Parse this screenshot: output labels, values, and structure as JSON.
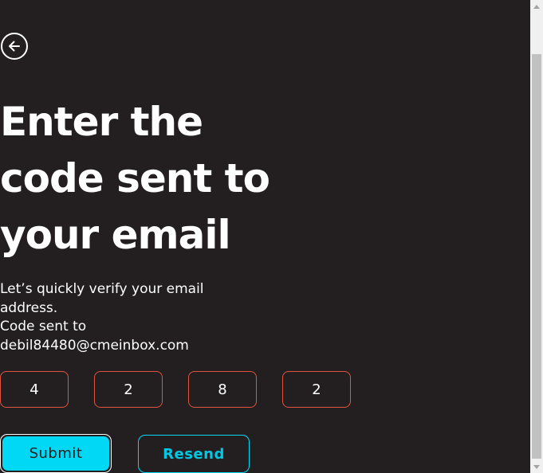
{
  "page": {
    "title_lines": [
      "Enter the",
      "code sent to",
      "your email"
    ],
    "subtitle_lines": [
      "Let’s quickly verify your email",
      "address.",
      "Code sent to",
      "debil84480@cmeinbox.com"
    ]
  },
  "code": {
    "digits": [
      "4",
      "2",
      "8",
      "2"
    ]
  },
  "buttons": {
    "back_icon": "arrow-left-circle-icon",
    "submit_label": "Submit",
    "resend_label": "Resend"
  },
  "colors": {
    "background": "#231f20",
    "accent_cyan": "#00d8f5",
    "code_border": "#e0533f",
    "text": "#ffffff"
  }
}
